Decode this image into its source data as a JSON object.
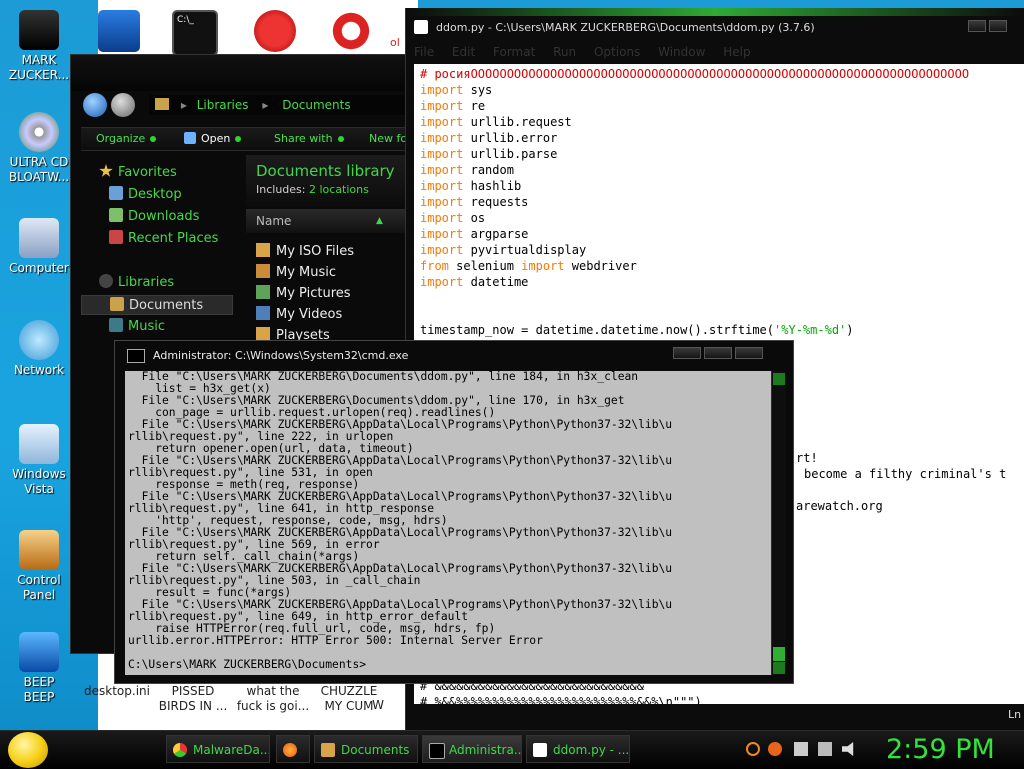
{
  "desktop": {
    "icons": [
      {
        "label_l1": "MARK",
        "label_l2": "ZUCKER..."
      },
      {
        "label_l1": "ULTRA CD",
        "label_l2": "BLOATW..."
      },
      {
        "label_l1": "Computer",
        "label_l2": ""
      },
      {
        "label_l1": "Network",
        "label_l2": ""
      },
      {
        "label_l1": "Windows",
        "label_l2": "Vista"
      },
      {
        "label_l1": "Control",
        "label_l2": "Panel"
      },
      {
        "label_l1": "BEEP",
        "label_l2": "BEEP"
      }
    ],
    "bottom_labels": [
      {
        "l1": "desktop.ini",
        "l2": ""
      },
      {
        "l1": "PISSED",
        "l2": "BIRDS IN ..."
      },
      {
        "l1": "what the",
        "l2": "fuck is goi..."
      },
      {
        "l1": "CHUZZLE",
        "l2": "MY CUM"
      },
      {
        "l1": "W",
        "l2": ""
      }
    ],
    "top_partial_text": "ol"
  },
  "explorer": {
    "breadcrumb": [
      "Libraries",
      "Documents"
    ],
    "commands": {
      "organize": "Organize",
      "open": "Open",
      "share": "Share with",
      "new": "New fo"
    },
    "nav": {
      "favorites": "Favorites",
      "desktop": "Desktop",
      "downloads": "Downloads",
      "recent": "Recent Places",
      "libraries": "Libraries",
      "documents": "Documents",
      "music": "Music"
    },
    "library_title": "Documents library",
    "includes_label": "Includes:",
    "includes_link": "2 locations",
    "column_name": "Name",
    "files": [
      "My ISO Files",
      "My Music",
      "My Pictures",
      "My Videos",
      "Playsets"
    ]
  },
  "idle": {
    "title": "ddom.py - C:\\Users\\MARK ZUCKERBERG\\Documents\\ddom.py (3.7.6)",
    "menu": [
      "File",
      "Edit",
      "Format",
      "Run",
      "Options",
      "Window",
      "Help"
    ],
    "first_comment": "# росия",
    "first_comment_tail": "OOOOOOOOOOOOOOOOOOOOOOOOOOOOOOOOOOOOOOOOOOOOOOOOOOOOOOOOOOOOOOOOOOOOO",
    "imports": [
      {
        "kw": "import",
        "mod": "sys"
      },
      {
        "kw": "import",
        "mod": "re"
      },
      {
        "kw": "import",
        "mod": "urllib.request"
      },
      {
        "kw": "import",
        "mod": "urllib.error"
      },
      {
        "kw": "import",
        "mod": "urllib.parse"
      },
      {
        "kw": "import",
        "mod": "random"
      },
      {
        "kw": "import",
        "mod": "hashlib"
      },
      {
        "kw": "import",
        "mod": "requests"
      },
      {
        "kw": "import",
        "mod": "os"
      },
      {
        "kw": "import",
        "mod": "argparse"
      },
      {
        "kw": "import",
        "mod": "pyvirtualdisplay"
      }
    ],
    "from_line": {
      "from": "from",
      "mod": "selenium",
      "import": "import",
      "name": "webdriver"
    },
    "last_import": {
      "kw": "import",
      "mod": "datetime"
    },
    "timestamp_code": "timestamp_now = datetime.datetime.now().strftime(",
    "timestamp_str": "'%Y-%m-%d'",
    "timestamp_end": ")",
    "fragment_1": "rt!",
    "fragment_2": "become a filthy criminal's t",
    "fragment_3": "arewatch.org",
    "bottom_line_1": "# &&&&&&&&&&&&&&&&&&&&&&&&&&&&&",
    "bottom_line_2": "# %&&%%%%%%%%%%%%%%%%%%%%%%%%%&&%\\n\"\"\")",
    "status": "Ln"
  },
  "cmd": {
    "title": "Administrator: C:\\Windows\\System32\\cmd.exe",
    "lines": [
      "  File \"C:\\Users\\MARK ZUCKERBERG\\Documents\\ddom.py\", line 184, in h3x_clean",
      "    list = h3x_get(x)",
      "  File \"C:\\Users\\MARK ZUCKERBERG\\Documents\\ddom.py\", line 170, in h3x_get",
      "    con_page = urllib.request.urlopen(req).readlines()",
      "  File \"C:\\Users\\MARK ZUCKERBERG\\AppData\\Local\\Programs\\Python\\Python37-32\\lib\\u",
      "rllib\\request.py\", line 222, in urlopen",
      "    return opener.open(url, data, timeout)",
      "  File \"C:\\Users\\MARK ZUCKERBERG\\AppData\\Local\\Programs\\Python\\Python37-32\\lib\\u",
      "rllib\\request.py\", line 531, in open",
      "    response = meth(req, response)",
      "  File \"C:\\Users\\MARK ZUCKERBERG\\AppData\\Local\\Programs\\Python\\Python37-32\\lib\\u",
      "rllib\\request.py\", line 641, in http_response",
      "    'http', request, response, code, msg, hdrs)",
      "  File \"C:\\Users\\MARK ZUCKERBERG\\AppData\\Local\\Programs\\Python\\Python37-32\\lib\\u",
      "rllib\\request.py\", line 569, in error",
      "    return self._call_chain(*args)",
      "  File \"C:\\Users\\MARK ZUCKERBERG\\AppData\\Local\\Programs\\Python\\Python37-32\\lib\\u",
      "rllib\\request.py\", line 503, in _call_chain",
      "    result = func(*args)",
      "  File \"C:\\Users\\MARK ZUCKERBERG\\AppData\\Local\\Programs\\Python\\Python37-32\\lib\\u",
      "rllib\\request.py\", line 649, in http_error_default",
      "    raise HTTPError(req.full_url, code, msg, hdrs, fp)",
      "urllib.error.HTTPError: HTTP Error 500: Internal Server Error",
      "",
      "C:\\Users\\MARK ZUCKERBERG\\Documents>"
    ]
  },
  "taskbar": {
    "buttons": [
      "MalwareDa...",
      "",
      "Documents",
      "Administra...",
      "ddom.py - ..."
    ],
    "clock": "2:59 PM"
  },
  "colors": {
    "accent_green": "#3fd84a",
    "desktop_blue": "#1fa0d8",
    "keyword_orange": "#ff7700",
    "comment_red": "#dd0000"
  }
}
